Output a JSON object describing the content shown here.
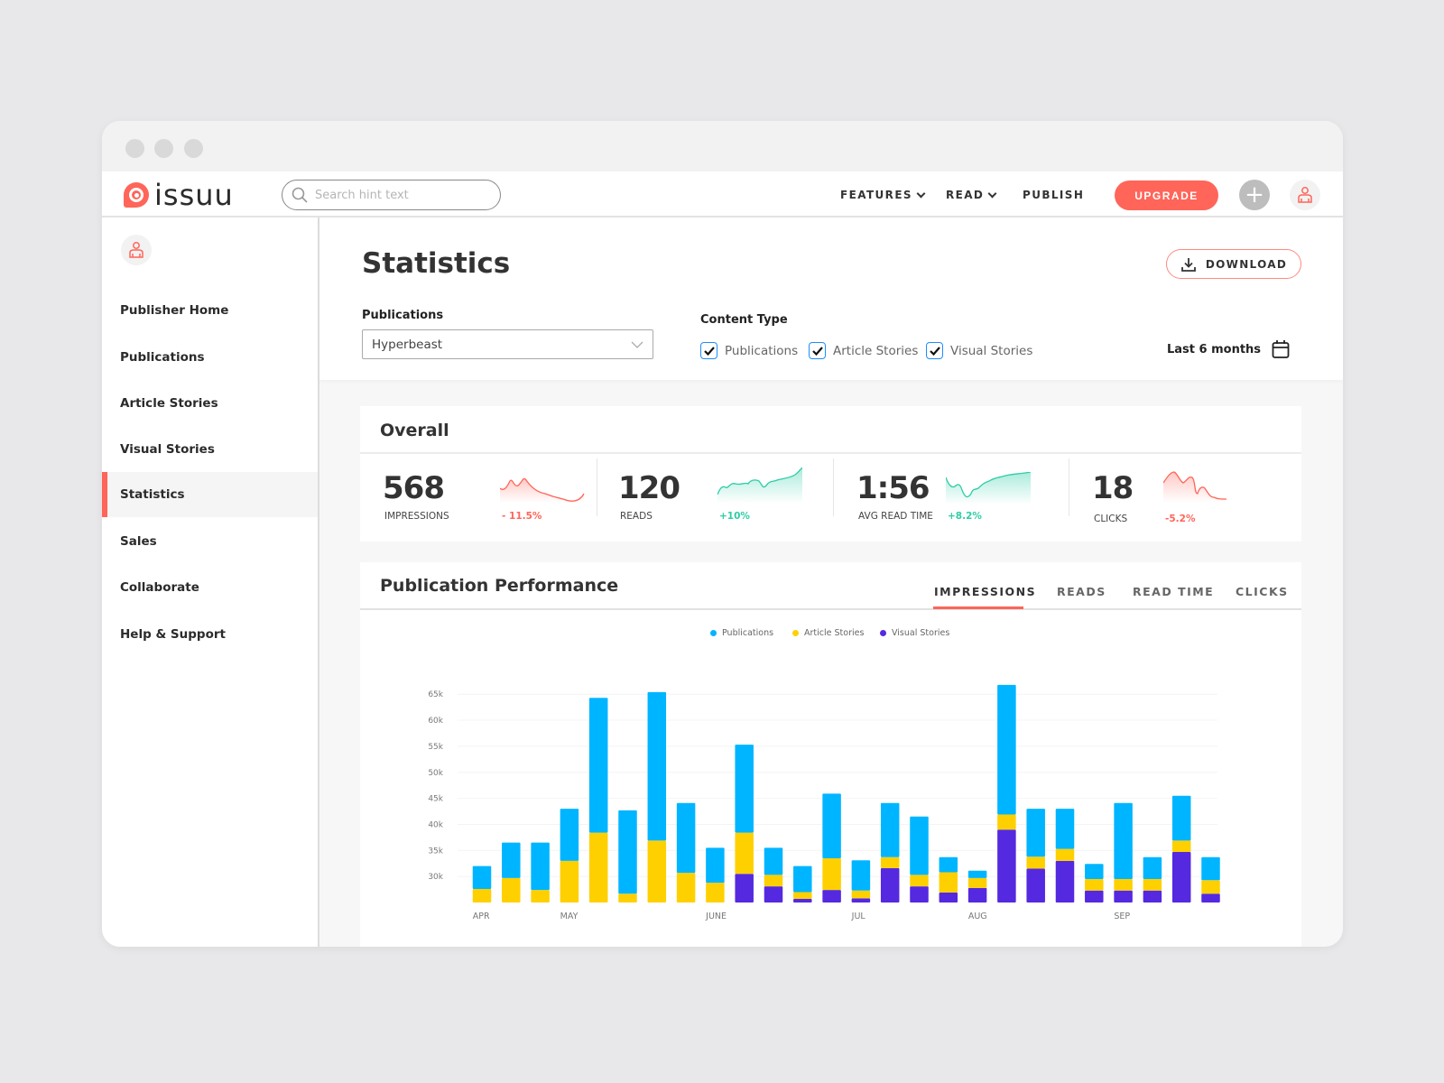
{
  "brand": {
    "name": "issuu",
    "accent": "#ff6559"
  },
  "header": {
    "search_placeholder": "Search hint text",
    "nav": [
      {
        "label": "FEATURES",
        "dropdown": true
      },
      {
        "label": "READ",
        "dropdown": true
      },
      {
        "label": "PUBLISH",
        "dropdown": false
      }
    ],
    "upgrade_label": "UPGRADE",
    "add_icon": "plus-icon",
    "avatar_icon": "user-icon"
  },
  "sidebar": {
    "items": [
      {
        "label": "Publisher Home"
      },
      {
        "label": "Publications"
      },
      {
        "label": "Article Stories"
      },
      {
        "label": "Visual Stories"
      },
      {
        "label": "Statistics",
        "active": true
      },
      {
        "label": "Sales"
      },
      {
        "label": "Collaborate"
      },
      {
        "label": "Help & Support"
      }
    ]
  },
  "main": {
    "title": "Statistics",
    "download_label": "DOWNLOAD",
    "publications_label": "Publications",
    "publication_selected": "Hyperbeast",
    "content_type_label": "Content Type",
    "content_types": [
      {
        "label": "Publications",
        "checked": true
      },
      {
        "label": "Article Stories",
        "checked": true
      },
      {
        "label": "Visual Stories",
        "checked": true
      }
    ],
    "date_range": "Last 6 months"
  },
  "overall": {
    "title": "Overall",
    "metrics": [
      {
        "value": "568",
        "label": "IMPRESSIONS",
        "change": "- 11.5%",
        "trend": "down"
      },
      {
        "value": "120",
        "label": "READS",
        "change": "+10%",
        "trend": "up"
      },
      {
        "value": "1:56",
        "label": "AVG READ TIME",
        "change": "+8.2%",
        "trend": "up"
      },
      {
        "value": "18",
        "label": "CLICKS",
        "change": "-5.2%",
        "trend": "down"
      }
    ],
    "colors": {
      "up": "#2ecda6",
      "down": "#ff6559"
    }
  },
  "performance": {
    "title": "Publication Performance",
    "tabs": [
      {
        "label": "IMPRESSIONS",
        "active": true
      },
      {
        "label": "READS"
      },
      {
        "label": "READ TIME"
      },
      {
        "label": "CLICKS"
      }
    ]
  },
  "chart_data": {
    "type": "bar",
    "stacked": true,
    "legend": "top-center",
    "grid": true,
    "ylim": [
      25000,
      67000
    ],
    "yticks": [
      "30k",
      "35k",
      "40k",
      "45k",
      "50k",
      "55k",
      "60k",
      "65k"
    ],
    "ytick_values": [
      30000,
      35000,
      40000,
      45000,
      50000,
      55000,
      60000,
      65000
    ],
    "month_labels": [
      {
        "label": "APR",
        "bar": 0
      },
      {
        "label": "MAY",
        "bar": 3
      },
      {
        "label": "JUNE",
        "bar": 8
      },
      {
        "label": "JUL",
        "bar": 13
      },
      {
        "label": "AUG",
        "bar": 17
      },
      {
        "label": "SEP",
        "bar": 22
      }
    ],
    "series": [
      {
        "name": "Visual Stories",
        "color": "#5429e0",
        "values": [
          0,
          0,
          0,
          0,
          0,
          0,
          0,
          0,
          0,
          5500,
          3100,
          700,
          2400,
          800,
          6600,
          3100,
          1900,
          2800,
          14000,
          6500,
          8000,
          2300,
          2300,
          2300,
          9700,
          1700
        ]
      },
      {
        "name": "Article Stories",
        "color": "#ffd000",
        "values": [
          2600,
          4700,
          2400,
          8000,
          13400,
          1700,
          11900,
          5700,
          3800,
          7900,
          2200,
          1300,
          6100,
          1500,
          2100,
          2200,
          3900,
          1900,
          2900,
          2300,
          2300,
          2200,
          2200,
          2200,
          2200,
          2600
        ]
      },
      {
        "name": "Publications",
        "color": "#00b5ff",
        "values": [
          4400,
          6800,
          9100,
          10000,
          25900,
          16000,
          28500,
          13400,
          6700,
          16900,
          5200,
          5000,
          12400,
          5800,
          10400,
          11200,
          2900,
          1400,
          24900,
          9200,
          7700,
          2900,
          14600,
          4200,
          8600,
          4400
        ]
      }
    ]
  }
}
